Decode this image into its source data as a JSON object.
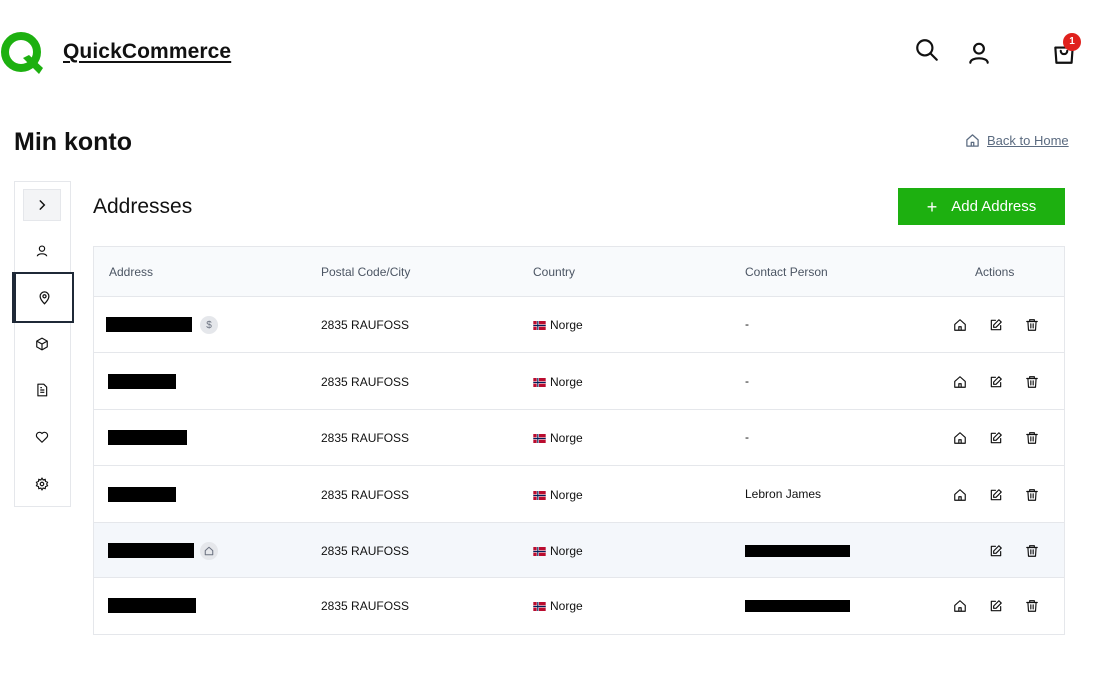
{
  "header": {
    "brand": "QuickCommerce",
    "logo_letter": "Q",
    "search_icon": "search-icon",
    "account_icon": "user-icon",
    "cart_icon": "shopping-bag-icon",
    "cart_count": "1"
  },
  "page": {
    "title": "Min konto",
    "back_home_label": "Back to Home"
  },
  "sidebar": {
    "items": [
      {
        "name": "expand",
        "icon": "chevron-right-icon"
      },
      {
        "name": "profile",
        "icon": "user-icon"
      },
      {
        "name": "addresses",
        "icon": "map-pin-icon",
        "active": true
      },
      {
        "name": "orders",
        "icon": "package-icon"
      },
      {
        "name": "documents",
        "icon": "file-text-icon"
      },
      {
        "name": "wishlist",
        "icon": "heart-icon"
      },
      {
        "name": "settings",
        "icon": "gear-icon"
      }
    ]
  },
  "addresses": {
    "title": "Addresses",
    "add_label": "Add Address",
    "columns": [
      "Address",
      "Postal Code/City",
      "Country",
      "Contact Person",
      "Actions"
    ],
    "rows": [
      {
        "postal": "2835 RAUFOSS",
        "country": "Norge",
        "contact": "-",
        "badge": "billing",
        "has_home_action": true
      },
      {
        "postal": "2835 RAUFOSS",
        "country": "Norge",
        "contact": "-",
        "badge": "",
        "has_home_action": true
      },
      {
        "postal": "2835 RAUFOSS",
        "country": "Norge",
        "contact": "-",
        "badge": "",
        "has_home_action": true
      },
      {
        "postal": "2835 RAUFOSS",
        "country": "Norge",
        "contact": "Lebron James",
        "badge": "",
        "has_home_action": true
      },
      {
        "postal": "2835 RAUFOSS",
        "country": "Norge",
        "contact": "",
        "badge": "home",
        "has_home_action": false
      },
      {
        "postal": "2835 RAUFOSS",
        "country": "Norge",
        "contact": "",
        "badge": "",
        "has_home_action": true
      }
    ]
  },
  "colors": {
    "brand_green": "#1db010",
    "badge_red": "#e0211d",
    "active_border": "#1f2937"
  }
}
